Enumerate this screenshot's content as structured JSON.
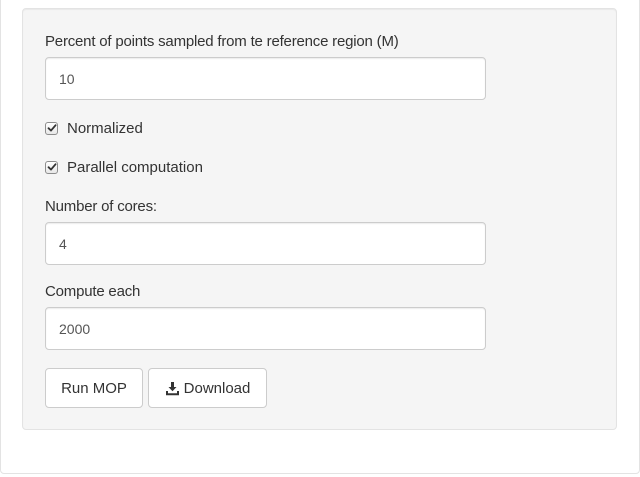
{
  "form": {
    "sample_percent": {
      "label": "Percent of points sampled from te reference region (M)",
      "value": "10"
    },
    "normalized": {
      "label": "Normalized",
      "checked": true
    },
    "parallel": {
      "label": "Parallel computation",
      "checked": true
    },
    "cores": {
      "label": "Number of cores:",
      "value": "4"
    },
    "compute_each": {
      "label": "Compute each",
      "value": "2000"
    }
  },
  "buttons": {
    "run_label": "Run MOP",
    "download_label": "Download",
    "download_icon": "download-icon"
  },
  "colors": {
    "well_bg": "#f5f5f5",
    "border": "#cccccc",
    "text": "#333333"
  }
}
